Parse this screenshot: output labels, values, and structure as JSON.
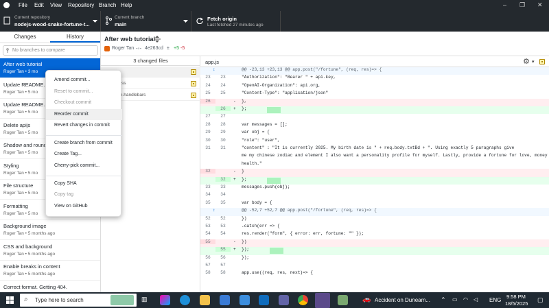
{
  "menubar": {
    "items": [
      "File",
      "Edit",
      "View",
      "Repository",
      "Branch",
      "Help"
    ],
    "window_controls": [
      "–",
      "❐",
      "✕"
    ]
  },
  "toolbar": {
    "repo_small": "Current repository",
    "repo_name": "nodejs-wood-snake-fortune-t...",
    "branch_small": "Current branch",
    "branch_name": "main",
    "fetch_title": "Fetch origin",
    "fetch_sub": "Last fetched 27 minutes ago"
  },
  "sidebar": {
    "tabs": [
      "Changes",
      "History"
    ],
    "branch_filter_placeholder": "No branches to compare",
    "commits": [
      {
        "title": "After web tutorial",
        "meta": "Roger Tan • 3 mo"
      },
      {
        "title": "Update README.m",
        "meta": "Roger Tan • 5 mo"
      },
      {
        "title": "Update README.m",
        "meta": "Roger Tan • 5 mo"
      },
      {
        "title": "Delete apijs",
        "meta": "Roger Tan • 5 mo"
      },
      {
        "title": "Shadow and round",
        "meta": "Roger Tan • 5 mo"
      },
      {
        "title": "Styling",
        "meta": "Roger Tan • 5 mo"
      },
      {
        "title": "File structure",
        "meta": "Roger Tan • 5 mo"
      },
      {
        "title": "Formatting",
        "meta": "Roger Tan • 5 mo"
      },
      {
        "title": "Background image",
        "meta": "Roger Tan • 5 months ago"
      },
      {
        "title": "CSS and background",
        "meta": "Roger Tan • 5 months ago"
      },
      {
        "title": "Enable breaks in content",
        "meta": "Roger Tan • 5 months ago"
      },
      {
        "title": "Correct format. Getting 404.",
        "meta": "Roger Tan • 5 months ago"
      }
    ]
  },
  "context_menu": {
    "items": [
      {
        "label": "Amend commit...",
        "disabled": false
      },
      {
        "label": "Reset to commit...",
        "disabled": true
      },
      {
        "label": "Checkout commit",
        "disabled": true
      },
      {
        "label": "Reorder commit",
        "disabled": false
      },
      {
        "label": "Revert changes in commit",
        "disabled": false
      },
      {
        "label": "Create branch from commit",
        "disabled": false
      },
      {
        "label": "Create Tag...",
        "disabled": false
      },
      {
        "label": "Cherry-pick commit...",
        "disabled": false
      },
      {
        "label": "Copy SHA",
        "disabled": false
      },
      {
        "label": "Copy tag",
        "disabled": true
      },
      {
        "label": "View on GitHub",
        "disabled": false
      }
    ]
  },
  "commit_header": {
    "title": "After web tutorial",
    "author": "Roger Tan",
    "sha": "4e263cd",
    "added": "+5",
    "removed": "-5"
  },
  "files_panel": {
    "count_label": "3 changed files",
    "files": [
      "",
      "ss\\styles.css",
      "youts\\main.handlebars"
    ]
  },
  "diff": {
    "filename": "app.js",
    "lines": [
      {
        "type": "hunk",
        "old": "",
        "new": "",
        "marker": "",
        "code": "@@ -23,13 +23,13 @@ app.post(\"/fortune\", (req, res)=> {"
      },
      {
        "type": "ctx",
        "old": "23",
        "new": "23",
        "marker": "",
        "code": "            \"Authorization\": \"Bearer \" + api.key,"
      },
      {
        "type": "ctx",
        "old": "24",
        "new": "24",
        "marker": "",
        "code": "            \"OpenAI-Organization\": api.org,"
      },
      {
        "type": "ctx",
        "old": "25",
        "new": "25",
        "marker": "",
        "code": "            \"Content-Type\": \"application/json\""
      },
      {
        "type": "del",
        "old": "26",
        "new": "",
        "marker": "-",
        "code": "        },"
      },
      {
        "type": "add",
        "old": "",
        "new": "26",
        "marker": "+",
        "code": "        };"
      },
      {
        "type": "ctx",
        "old": "27",
        "new": "27",
        "marker": "",
        "code": ""
      },
      {
        "type": "ctx",
        "old": "28",
        "new": "28",
        "marker": "",
        "code": "        var messages = [];"
      },
      {
        "type": "ctx",
        "old": "29",
        "new": "29",
        "marker": "",
        "code": "        var obj = {"
      },
      {
        "type": "ctx",
        "old": "30",
        "new": "30",
        "marker": "",
        "code": "            \"role\": \"user\","
      },
      {
        "type": "ctx",
        "old": "31",
        "new": "31",
        "marker": "",
        "code": "            \"content\" : \"It is currently 2025. My birth date is \" + req.body.txtBd + \". Using exactly 5 paragraphs give"
      },
      {
        "type": "wrap",
        "old": "",
        "new": "",
        "marker": "",
        "code": "me my chinese zodiac and element I also want a personality profile for myself. Lastly, provide a fortune for love, money and"
      },
      {
        "type": "wrap",
        "old": "",
        "new": "",
        "marker": "",
        "code": "health.\""
      },
      {
        "type": "del",
        "old": "32",
        "new": "",
        "marker": "-",
        "code": "        }"
      },
      {
        "type": "add",
        "old": "",
        "new": "32",
        "marker": "+",
        "code": "        };"
      },
      {
        "type": "ctx",
        "old": "33",
        "new": "33",
        "marker": "",
        "code": "        messages.push(obj);"
      },
      {
        "type": "ctx",
        "old": "34",
        "new": "34",
        "marker": "",
        "code": ""
      },
      {
        "type": "ctx",
        "old": "35",
        "new": "35",
        "marker": "",
        "code": "        var body = {"
      },
      {
        "type": "hunk",
        "old": "",
        "new": "",
        "marker": "",
        "code": "@@ -52,7 +52,7 @@ app.post(\"/fortune\", (req, res)=> {"
      },
      {
        "type": "ctx",
        "old": "52",
        "new": "52",
        "marker": "",
        "code": "        })"
      },
      {
        "type": "ctx",
        "old": "53",
        "new": "53",
        "marker": "",
        "code": "        .catch(err => {"
      },
      {
        "type": "ctx",
        "old": "54",
        "new": "54",
        "marker": "",
        "code": "            res.render(\"form\", { error: err, fortune: \"\" });"
      },
      {
        "type": "del",
        "old": "55",
        "new": "",
        "marker": "-",
        "code": "        })"
      },
      {
        "type": "add",
        "old": "",
        "new": "55",
        "marker": "+",
        "code": "        });"
      },
      {
        "type": "ctx",
        "old": "56",
        "new": "56",
        "marker": "",
        "code": "});"
      },
      {
        "type": "ctx",
        "old": "57",
        "new": "57",
        "marker": "",
        "code": ""
      },
      {
        "type": "ctx",
        "old": "58",
        "new": "58",
        "marker": "",
        "code": "app.use((req, res, next)=> {"
      }
    ]
  },
  "taskbar": {
    "search_placeholder": "Type here to search",
    "weather_text": "Accident on Duneam...",
    "lang": "ENG",
    "time": "9:58 PM",
    "date": "18/5/2025"
  }
}
